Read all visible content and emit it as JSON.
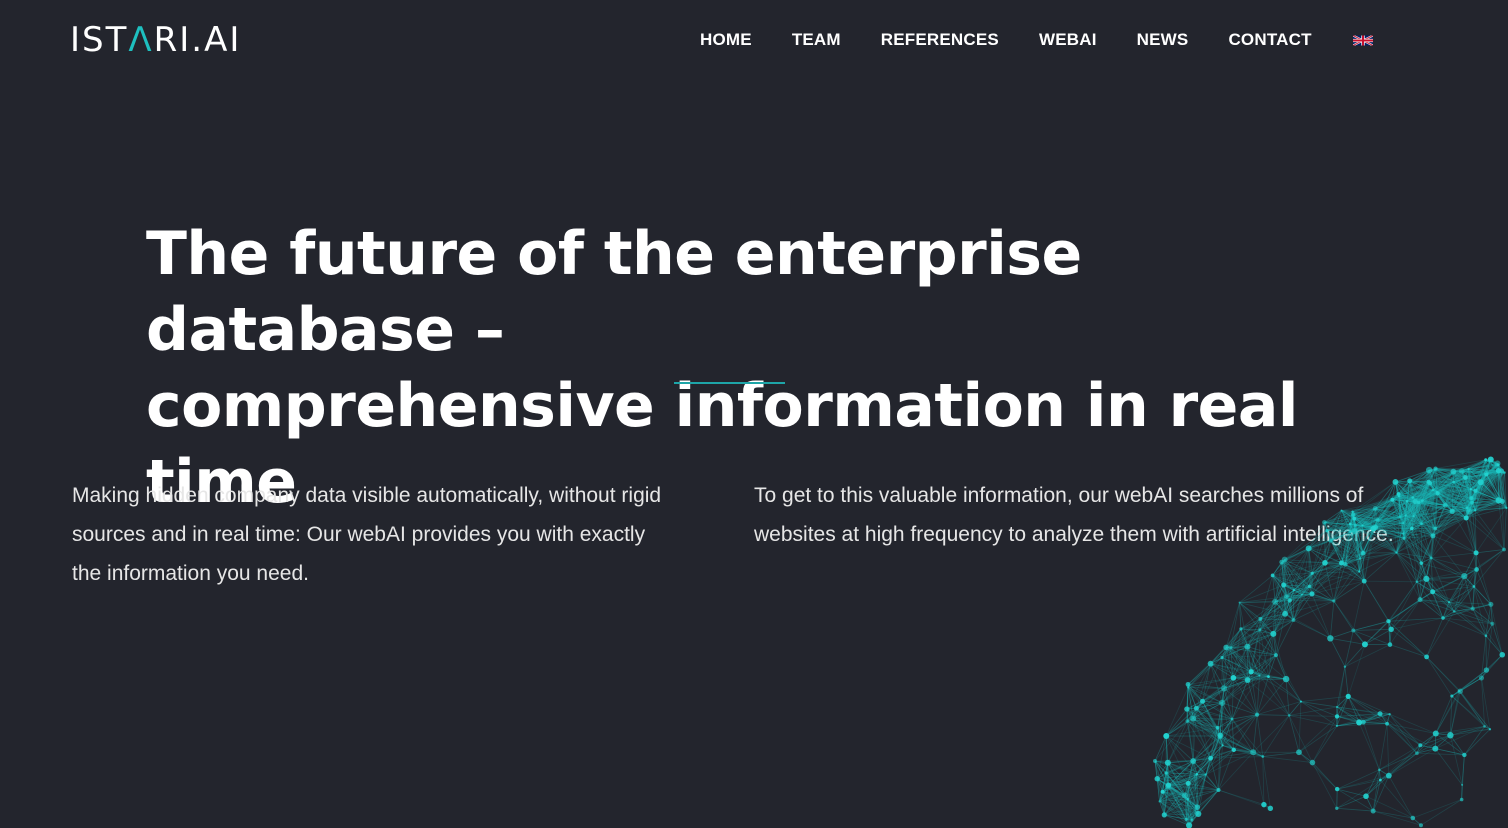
{
  "brand": {
    "logo_text_1": "IST",
    "logo_text_accent": "Λ",
    "logo_text_2": "RI.AI",
    "accent_color": "#1ec0c0",
    "background_color": "#23252d"
  },
  "nav": {
    "items": [
      {
        "label": "HOME"
      },
      {
        "label": "TEAM"
      },
      {
        "label": "REFERENCES"
      },
      {
        "label": "WEBAI"
      },
      {
        "label": "NEWS"
      },
      {
        "label": "CONTACT"
      }
    ],
    "language_icon": "uk-flag-icon"
  },
  "hero": {
    "headline_line1": "The future of the enterprise database –",
    "headline_line2": "comprehensive information in real time"
  },
  "intro": {
    "left_text": "Making hidden company data visible automatically, without rigid sources and in real time: Our webAI provides you with exactly the information you need.",
    "right_text": "To get to this valuable information, our webAI searches millions of websites at high frequency to analyze them with artificial intelligence."
  },
  "decoration": {
    "globe_icon": "network-globe-graphic"
  }
}
